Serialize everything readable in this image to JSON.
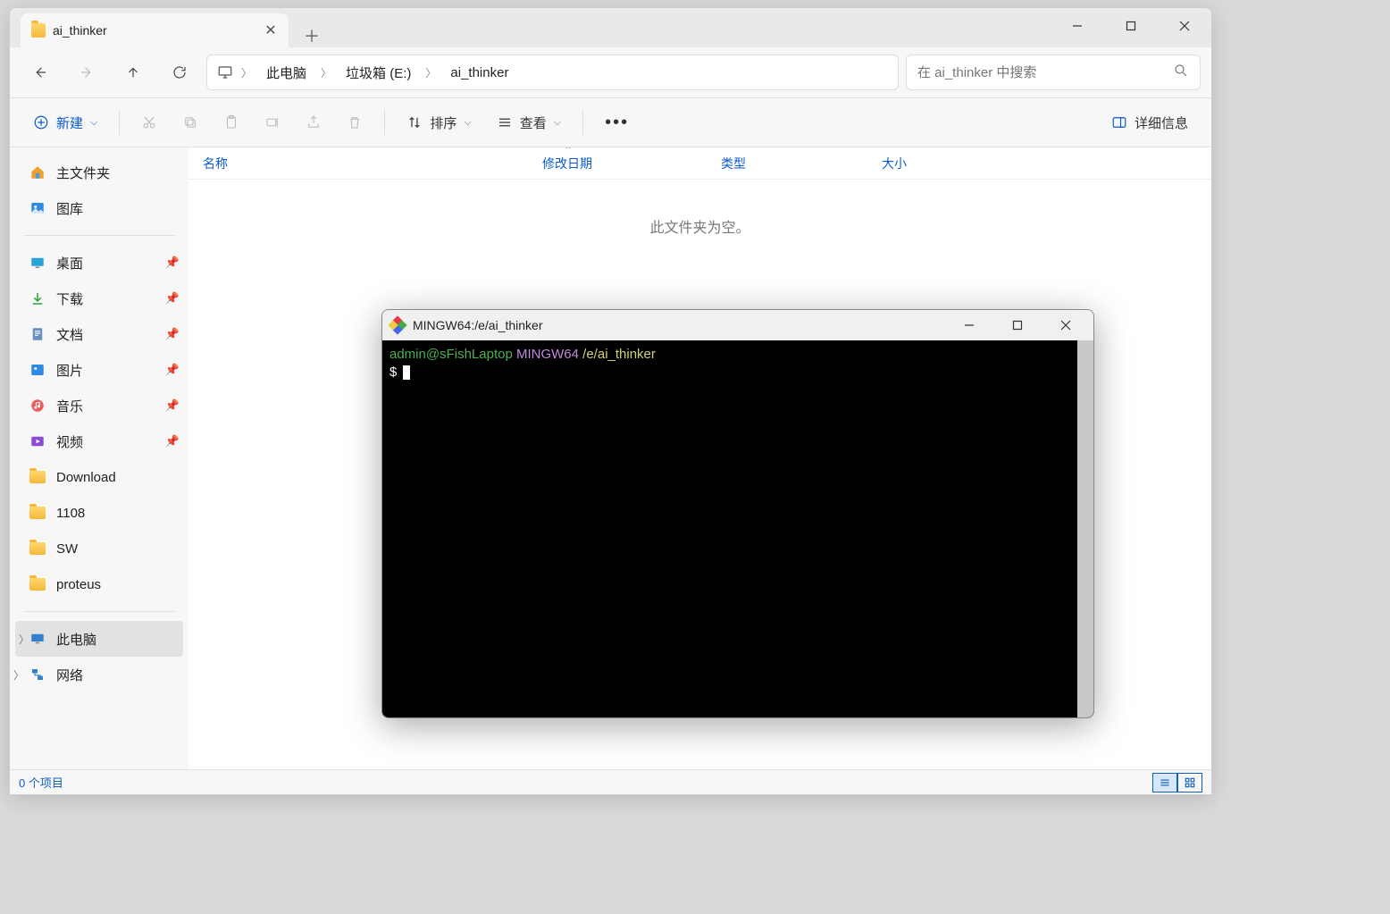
{
  "explorer": {
    "tab_title": "ai_thinker",
    "breadcrumb": {
      "segments": [
        "此电脑",
        "垃圾箱 (E:)",
        "ai_thinker"
      ]
    },
    "search_placeholder": "在 ai_thinker 中搜索",
    "toolbar": {
      "new_label": "新建",
      "sort_label": "排序",
      "view_label": "查看",
      "details_label": "详细信息"
    },
    "columns": {
      "name": "名称",
      "modified": "修改日期",
      "type": "类型",
      "size": "大小"
    },
    "empty_text": "此文件夹为空。",
    "sidebar": {
      "home": "主文件夹",
      "gallery": "图库",
      "pinned": [
        {
          "label": "桌面",
          "icon": "desktop"
        },
        {
          "label": "下载",
          "icon": "download"
        },
        {
          "label": "文档",
          "icon": "document"
        },
        {
          "label": "图片",
          "icon": "pictures"
        },
        {
          "label": "音乐",
          "icon": "music"
        },
        {
          "label": "视频",
          "icon": "video"
        }
      ],
      "folders": [
        "Download",
        "1108",
        "SW",
        "proteus"
      ],
      "this_pc": "此电脑",
      "network": "网络"
    },
    "status": "0 个项目"
  },
  "terminal": {
    "title": "MINGW64:/e/ai_thinker",
    "user": "admin@sFishLaptop",
    "env": "MINGW64",
    "path": "/e/ai_thinker",
    "prompt": "$"
  }
}
